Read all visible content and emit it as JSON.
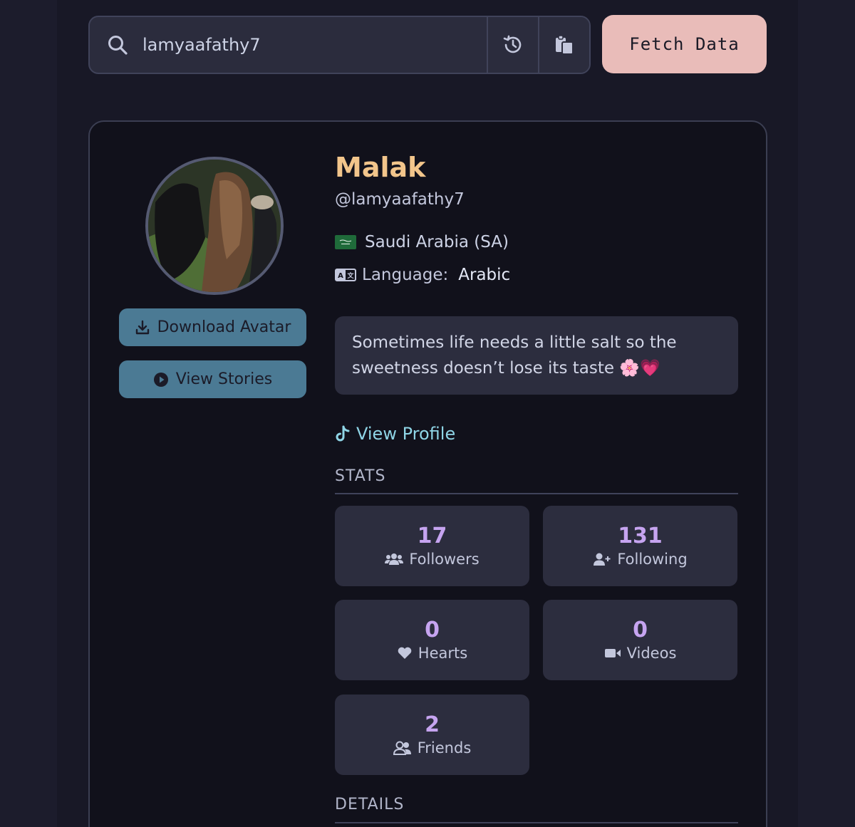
{
  "search": {
    "value": "lamyaafathy7",
    "fetch_label": "Fetch Data"
  },
  "profile": {
    "name": "Malak",
    "username": "@lamyaafathy7",
    "country": "Saudi Arabia (SA)",
    "language_label": "Language:",
    "language_value": "Arabic",
    "bio": "Sometimes life needs a little salt so the sweetness doesn’t lose its taste 🌸💗",
    "view_profile_label": "View Profile"
  },
  "actions": {
    "download_avatar": "Download Avatar",
    "view_stories": "View Stories"
  },
  "sections": {
    "stats": "STATS",
    "details": "DETAILS"
  },
  "stats": [
    {
      "value": "17",
      "label": "Followers",
      "icon": "users-icon"
    },
    {
      "value": "131",
      "label": "Following",
      "icon": "user-plus-icon"
    },
    {
      "value": "0",
      "label": "Hearts",
      "icon": "heart-icon"
    },
    {
      "value": "0",
      "label": "Videos",
      "icon": "video-icon"
    },
    {
      "value": "2",
      "label": "Friends",
      "icon": "user-friends-icon"
    }
  ],
  "colors": {
    "accent_name": "#f2c58b",
    "stat_value": "#c6a4f0",
    "fetch_button": "#e9bcb9",
    "action_button": "#4b7a94",
    "link": "#8fd5e6"
  }
}
